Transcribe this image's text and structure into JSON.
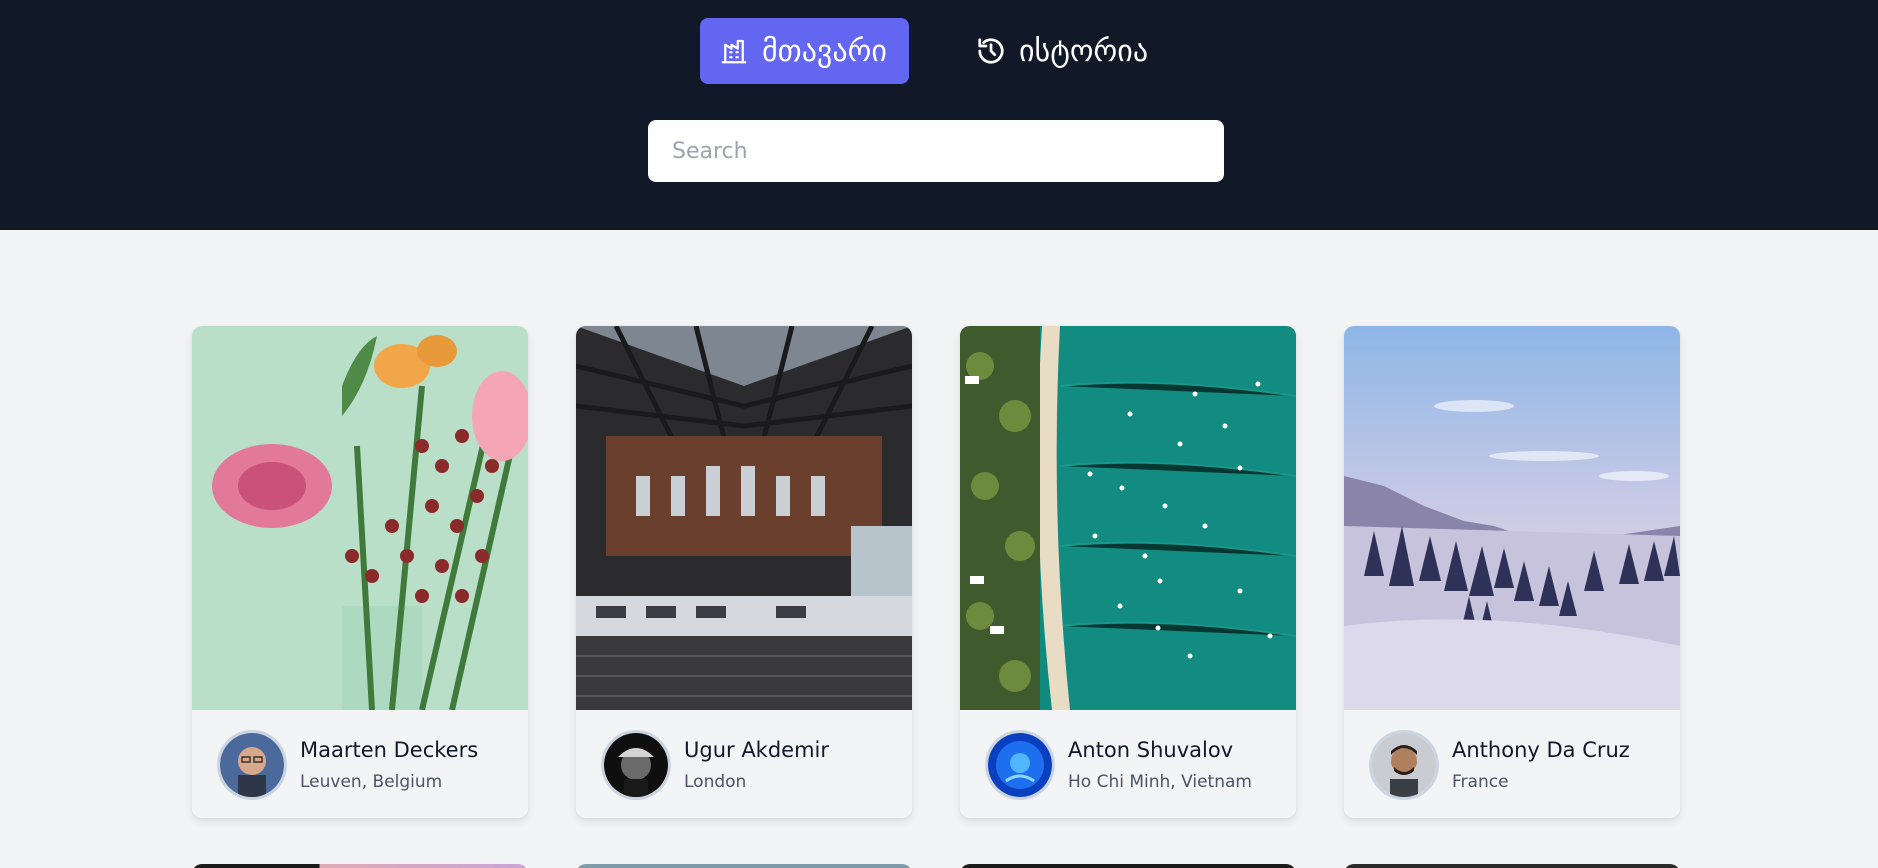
{
  "nav": {
    "home_label": "მთავარი",
    "home_icon": "factory-icon",
    "history_label": "ისტორია",
    "history_icon": "history-icon",
    "accent_color": "#6366f1",
    "header_bg": "#111827"
  },
  "search": {
    "placeholder": "Search",
    "value": ""
  },
  "cards": [
    {
      "name": "Maarten Deckers",
      "location": "Leuven, Belgium"
    },
    {
      "name": "Ugur Akdemir",
      "location": "London"
    },
    {
      "name": "Anton Shuvalov",
      "location": "Ho Chi Minh, Vietnam"
    },
    {
      "name": "Anthony Da Cruz",
      "location": "France"
    }
  ]
}
